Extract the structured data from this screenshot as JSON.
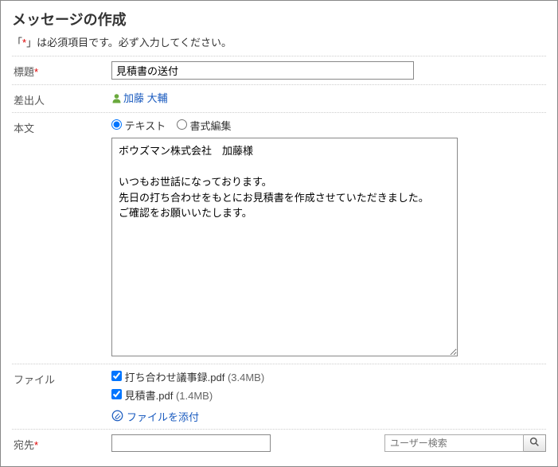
{
  "page_title": "メッセージの作成",
  "required_note_pre": "「",
  "required_note_ast": "*",
  "required_note_post": "」は必須項目です。必ず入力してください。",
  "labels": {
    "subject": "標題",
    "sender": "差出人",
    "body": "本文",
    "file": "ファイル",
    "recipient": "宛先"
  },
  "subject_value": "見積書の送付",
  "sender_name": "加藤 大輔",
  "body_format": {
    "text": "テキスト",
    "rich": "書式編集"
  },
  "body_value": "ボウズマン株式会社　加藤様\n\nいつもお世話になっております。\n先日の打ち合わせをもとにお見積書を作成させていただきました。\nご確認をお願いいたします。",
  "files": [
    {
      "name": "打ち合わせ議事録.pdf",
      "size": "(3.4MB)"
    },
    {
      "name": "見積書.pdf",
      "size": "(1.4MB)"
    }
  ],
  "attach_label": "ファイルを添付",
  "search_placeholder": "ユーザー検索"
}
